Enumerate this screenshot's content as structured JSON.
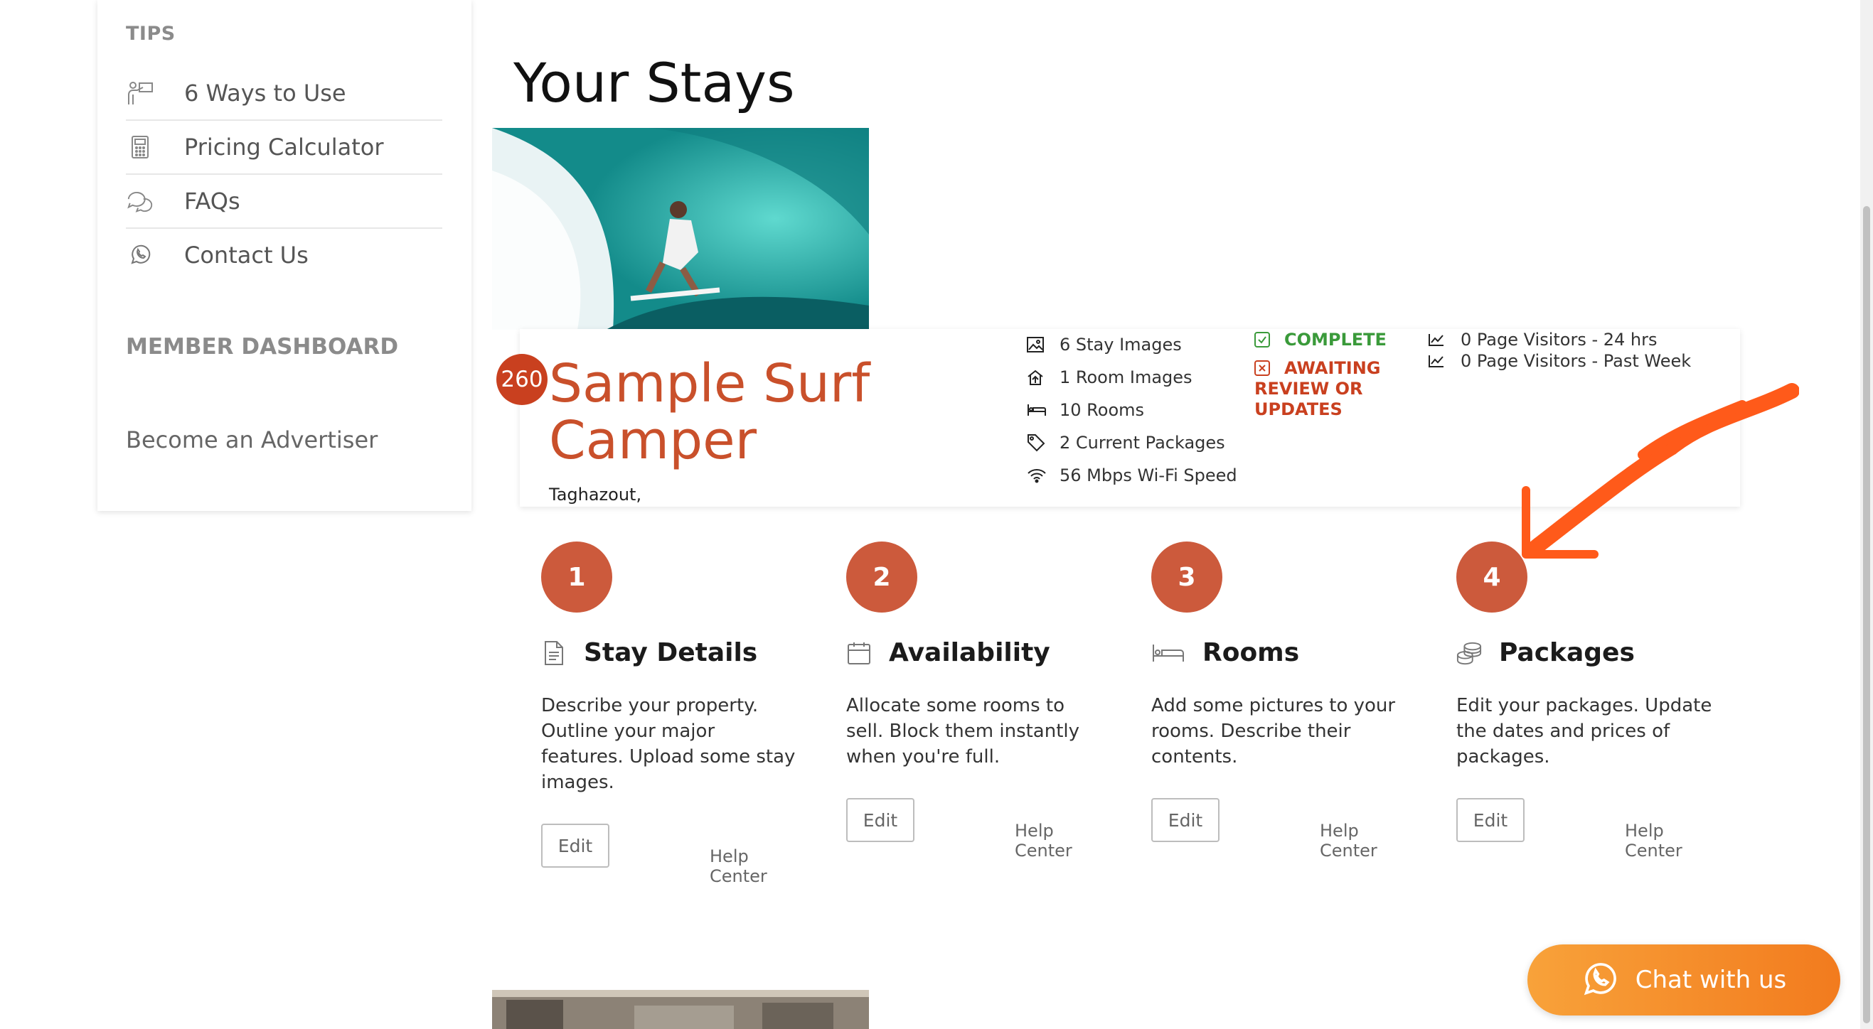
{
  "sidebar": {
    "tips_heading": "TIPS",
    "items": [
      {
        "label": "6 Ways to Use",
        "icon": "presenter-icon"
      },
      {
        "label": "Pricing Calculator",
        "icon": "calculator-icon"
      },
      {
        "label": "FAQs",
        "icon": "chat-bubbles-icon"
      },
      {
        "label": "Contact Us",
        "icon": "whatsapp-icon"
      }
    ],
    "member_heading": "MEMBER DASHBOARD",
    "advertiser_link": "Become an Advertiser"
  },
  "main": {
    "title": "Your Stays",
    "stay": {
      "badge": "260",
      "name": "Sample Surf Camper",
      "location": "Taghazout,",
      "stats": [
        {
          "label": "6 Stay Images",
          "icon": "image-icon"
        },
        {
          "label": "1 Room Images",
          "icon": "house-upload-icon"
        },
        {
          "label": "10 Rooms",
          "icon": "bed-icon"
        },
        {
          "label": "2 Current Packages",
          "icon": "tag-icon"
        },
        {
          "label": "56 Mbps Wi-Fi Speed",
          "icon": "wifi-icon"
        }
      ],
      "status_complete": "COMPLETE",
      "status_awaiting": "AWAITING REVIEW OR UPDATES",
      "visitors_24h": "0 Page Visitors - 24 hrs",
      "visitors_week": "0 Page Visitors - Past Week"
    },
    "steps": [
      {
        "number": "1",
        "title": "Stay Details",
        "icon": "document-icon",
        "description": "Describe your property. Outline your major features. Upload some stay images.",
        "edit": "Edit",
        "help": "Help Center"
      },
      {
        "number": "2",
        "title": "Availability",
        "icon": "calendar-icon",
        "description": "Allocate some rooms to sell. Block them instantly when you're full.",
        "edit": "Edit",
        "help": "Help Center"
      },
      {
        "number": "3",
        "title": "Rooms",
        "icon": "bed-icon",
        "description": "Add some pictures to your rooms. Describe their contents.",
        "edit": "Edit",
        "help": "Help Center"
      },
      {
        "number": "4",
        "title": "Packages",
        "icon": "coins-icon",
        "description": "Edit your packages. Update the dates and prices of packages.",
        "edit": "Edit",
        "help": "Help Center"
      }
    ]
  },
  "chat": {
    "label": "Chat with us",
    "icon": "whatsapp-icon"
  },
  "colors": {
    "accent": "#c9502b",
    "complete": "#3a9a3a",
    "chat": "#f58a2a",
    "annotation": "#ff5a1a"
  }
}
